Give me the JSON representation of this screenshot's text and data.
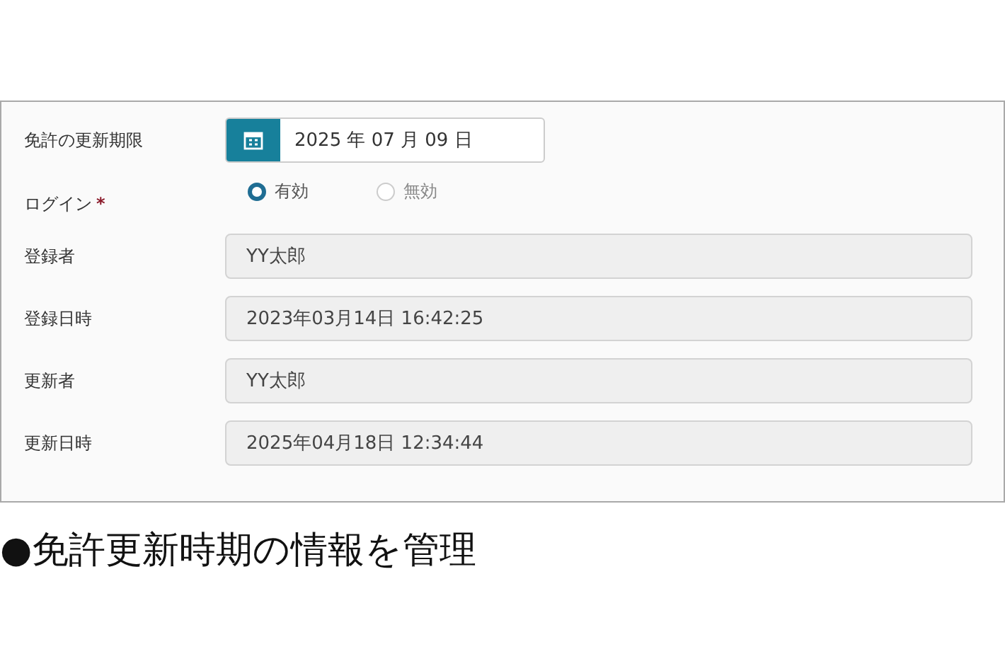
{
  "form": {
    "rows": [
      {
        "kind": "date",
        "label": "免許の更新期限",
        "value": "2025 年 07 月 09 日"
      },
      {
        "kind": "radio",
        "label": "ログイン",
        "required_mark": "*",
        "options": [
          {
            "label": "有効",
            "selected": true
          },
          {
            "label": "無効",
            "selected": false
          }
        ]
      },
      {
        "kind": "readonly",
        "label": "登録者",
        "value": "YY太郎"
      },
      {
        "kind": "readonly",
        "label": "登録日時",
        "value": "2023年03月14日 16:42:25"
      },
      {
        "kind": "readonly",
        "label": "更新者",
        "value": "YY太郎"
      },
      {
        "kind": "readonly",
        "label": "更新日時",
        "value": "2025年04月18日 12:34:44"
      }
    ]
  },
  "caption": "●免許更新時期の情報を管理"
}
